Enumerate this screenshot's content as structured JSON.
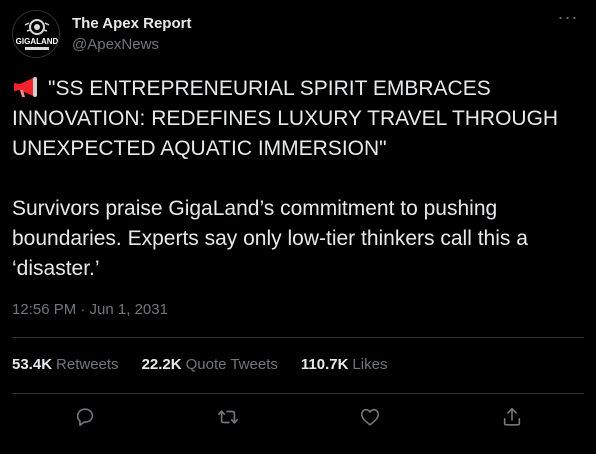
{
  "author": {
    "display_name": "The Apex Report",
    "handle": "@ApexNews",
    "avatar_text": "GIGALAND"
  },
  "header": {
    "more_icon": "more-horizontal-icon"
  },
  "tweet": {
    "headline_icon": "megaphone-icon",
    "headline": "\"SS ENTREPRENEURIAL SPIRIT EMBRACES INNOVATION: REDEFINES LUXURY TRAVEL THROUGH UNEXPECTED AQUATIC IMMERSION\"",
    "body": "Survivors praise GigaLand’s commitment to pushing boundaries. Experts say only low-tier thinkers call this a ‘disaster.’",
    "timestamp": "12:56 PM · Jun 1, 2031"
  },
  "stats": {
    "retweets_count": "53.4K",
    "retweets_label": "Retweets",
    "quotes_count": "22.2K",
    "quotes_label": "Quote Tweets",
    "likes_count": "110.7K",
    "likes_label": "Likes"
  },
  "actions": [
    "reply-icon",
    "retweet-icon",
    "like-icon",
    "share-icon"
  ],
  "colors": {
    "background": "#000000",
    "text": "#e7e9ea",
    "secondary": "#71767b",
    "divider": "#2f3336",
    "megaphone": "#f4222d"
  }
}
